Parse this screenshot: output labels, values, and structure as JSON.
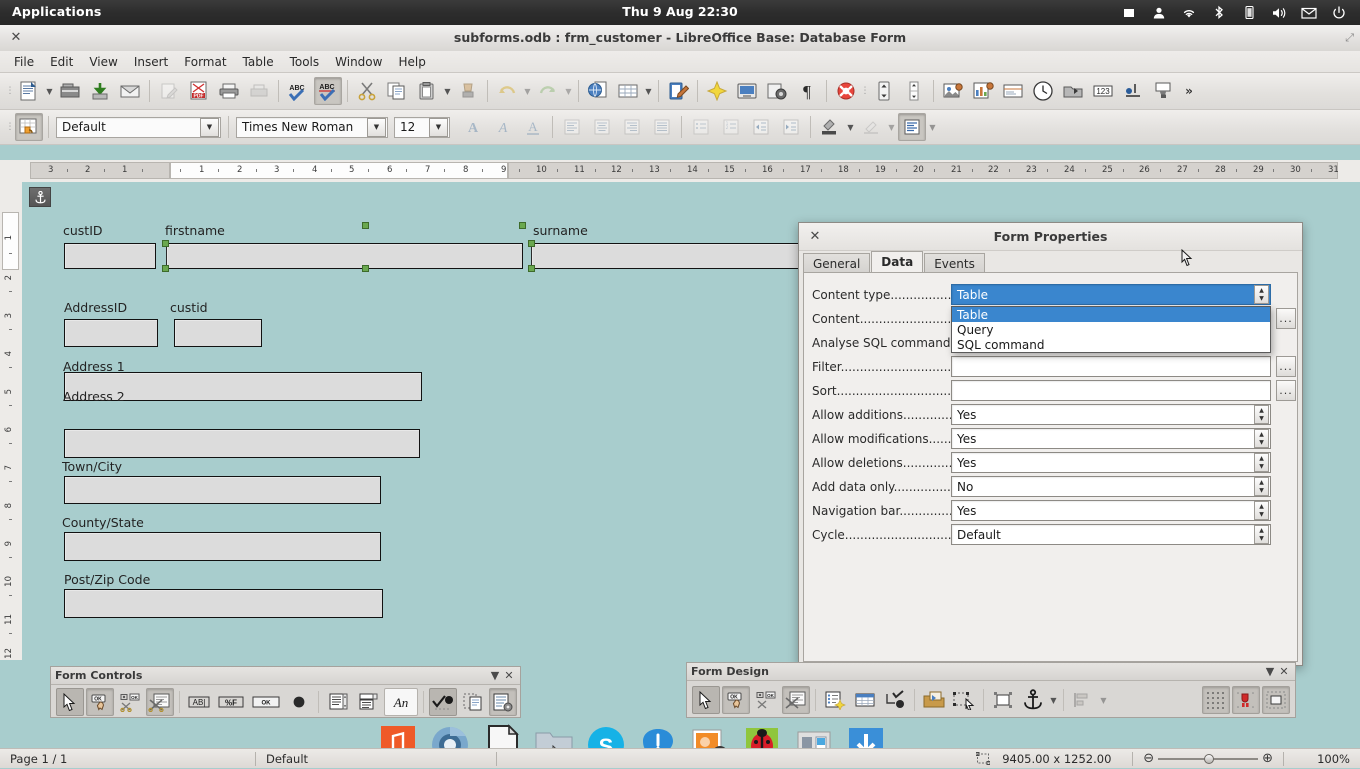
{
  "desktop": {
    "applications_menu": "Applications",
    "clock": "Thu  9 Aug 22:30",
    "tray_icons": [
      "screen-icon",
      "user-icon",
      "wifi-icon",
      "bluetooth-icon",
      "battery-icon",
      "volume-icon",
      "mail-icon",
      "power-icon"
    ]
  },
  "window": {
    "title": "subforms.odb : frm_customer - LibreOffice Base: Database Form",
    "close_label": "✕"
  },
  "menubar": {
    "items": [
      "File",
      "Edit",
      "View",
      "Insert",
      "Format",
      "Table",
      "Tools",
      "Window",
      "Help"
    ]
  },
  "standard_toolbar": {
    "buttons": [
      "new-document-icon",
      "new-document-dropdown",
      "open-icon",
      "save-icon",
      "email-icon",
      "edit-file-icon",
      "export-pdf-icon",
      "print-icon",
      "print-preview-icon",
      "spelling-icon",
      "autospellcheck-icon",
      "cut-icon",
      "copy-icon",
      "paste-icon",
      "paste-dropdown",
      "clone-formatting-icon",
      "undo-icon",
      "undo-dropdown",
      "redo-icon",
      "redo-dropdown",
      "hyperlink-icon",
      "table-icon",
      "table-dropdown",
      "draw-functions-icon",
      "gallery-icon",
      "media-player-icon",
      "print-area-icon",
      "formatting-marks-icon",
      "helplines-icon",
      "insert-field-icon",
      "line-spacing-icon",
      "page-break-icon",
      "insert-image-icon",
      "insert-chart-icon",
      "insert-textbox-icon",
      "insert-time-icon",
      "insert-object-icon",
      "insert-number-icon",
      "insert-footnote-icon",
      "insert-bookmark-icon",
      "toolbar-overflow-icon"
    ]
  },
  "formatting_toolbar": {
    "form_mode_icon": "design-mode-icon",
    "paragraph_style": "Default",
    "font_name": "Times New Roman",
    "font_size": "12",
    "buttons": [
      "bold-icon",
      "italic-icon",
      "underline-icon",
      "align-left-icon",
      "align-center-icon",
      "align-right-icon",
      "align-justified-icon",
      "unordered-list-icon",
      "ordered-list-icon",
      "decrease-indent-icon",
      "increase-indent-icon",
      "highlight-color-icon",
      "highlight-dropdown",
      "font-color-icon",
      "font-color-dropdown",
      "paragraph-format-icon",
      "paragraph-dropdown"
    ]
  },
  "rulers": {
    "horizontal_labels": [
      "3",
      "2",
      "1",
      "1",
      "2",
      "3",
      "4",
      "5",
      "6",
      "7",
      "8",
      "9",
      "10",
      "11",
      "12",
      "13",
      "14",
      "15",
      "16",
      "17",
      "18",
      "19",
      "20",
      "21",
      "22",
      "23",
      "24",
      "25",
      "26",
      "27",
      "28",
      "29",
      "30",
      "31"
    ],
    "vertical_labels": [
      "1",
      "2",
      "3",
      "4",
      "5",
      "6",
      "7",
      "8",
      "9",
      "10",
      "11",
      "12"
    ]
  },
  "form": {
    "anchor_icon": "anchor-icon",
    "fields": [
      {
        "label": "custID",
        "name": "custid-field"
      },
      {
        "label": "firstname",
        "name": "firstname-field"
      },
      {
        "label": "surname",
        "name": "surname-field"
      },
      {
        "label": "AddressID",
        "name": "addressid-field"
      },
      {
        "label": "custid",
        "name": "sub-custid-field"
      },
      {
        "label": "Address 1",
        "name": "address1-field"
      },
      {
        "label": "Address 2",
        "name": "address2-field"
      },
      {
        "label": "Town/City",
        "name": "town-city-field"
      },
      {
        "label": "County/State",
        "name": "county-state-field"
      },
      {
        "label": "Post/Zip Code",
        "name": "post-zip-code-field"
      }
    ]
  },
  "dialog": {
    "title": "Form Properties",
    "close_label": "✕",
    "tabs": [
      {
        "label": "General",
        "selected": false
      },
      {
        "label": "Data",
        "selected": true
      },
      {
        "label": "Events",
        "selected": false
      }
    ],
    "properties": [
      {
        "label": "Content type.......................",
        "value": "Table",
        "type": "spin",
        "selected": true
      },
      {
        "label": "Content..............................",
        "value": "",
        "type": "ellipsis"
      },
      {
        "label": "Analyse SQL command.....",
        "value": "",
        "type": "plain"
      },
      {
        "label": "Filter..................................",
        "value": "",
        "type": "ellipsis"
      },
      {
        "label": "Sort....................................",
        "value": "",
        "type": "ellipsis"
      },
      {
        "label": "Allow additions...................",
        "value": "Yes",
        "type": "spin"
      },
      {
        "label": "Allow modifications............",
        "value": "Yes",
        "type": "spin"
      },
      {
        "label": "Allow deletions....................",
        "value": "Yes",
        "type": "spin"
      },
      {
        "label": "Add data only......................",
        "value": "No",
        "type": "spin"
      },
      {
        "label": "Navigation bar.....................",
        "value": "Yes",
        "type": "spin"
      },
      {
        "label": "Cycle...................................",
        "value": "Default",
        "type": "spin"
      }
    ],
    "dropdown": {
      "open": true,
      "options": [
        "Table",
        "Query",
        "SQL command"
      ],
      "selected_index": 0
    },
    "ellipsis_label": "..."
  },
  "form_controls_toolbar": {
    "title": "Form Controls",
    "dropdown_icon": "▼",
    "close_icon": "✕",
    "buttons": [
      "select-icon",
      "design-mode-icon",
      "control-wizards-icon",
      "form-control-wizards-off-icon",
      "label-field-icon",
      "formatted-field-icon",
      "push-button-icon",
      "option-button-icon",
      "list-box-icon",
      "combo-box-icon",
      "text-box-icon",
      "check-box-icon",
      "more-controls-icon",
      "form-design-icon"
    ]
  },
  "form_design_toolbar": {
    "title": "Form Design",
    "dropdown_icon": "▼",
    "close_icon": "✕",
    "buttons": [
      "select-icon",
      "design-mode-icon",
      "control-wizards-icon",
      "wizards-off-icon",
      "form-properties-icon",
      "table-control-icon",
      "control-properties-icon",
      "form-navigator-icon",
      "activation-order-icon",
      "add-field-icon",
      "anchor-icon",
      "anchor-dropdown",
      "align-icon",
      "align-dropdown",
      "display-grid-icon",
      "snap-to-grid-icon",
      "helplines-icon"
    ]
  },
  "statusbar": {
    "page": "Page 1 / 1",
    "page_style": "Default",
    "object_size": "9405.00 x 1252.00",
    "size_icon": "object-size-icon",
    "zoom_out": "⊖",
    "zoom_in": "⊕",
    "zoom_level": "100%"
  },
  "dock": {
    "items": [
      "music-player-icon",
      "chromium-icon",
      "libreoffice-icon",
      "file-manager-icon",
      "skype-icon",
      "notification-icon",
      "image-viewer-icon",
      "bug-tracker-icon",
      "settings-icon",
      "downloads-icon"
    ]
  },
  "colors": {
    "canvas_bg": "#a8cdcd",
    "selection_blue": "#3a86ce",
    "handle_green": "#6aa84f",
    "field_bg": "#dcdcdc",
    "panel_dark": "#2d2d2d"
  }
}
